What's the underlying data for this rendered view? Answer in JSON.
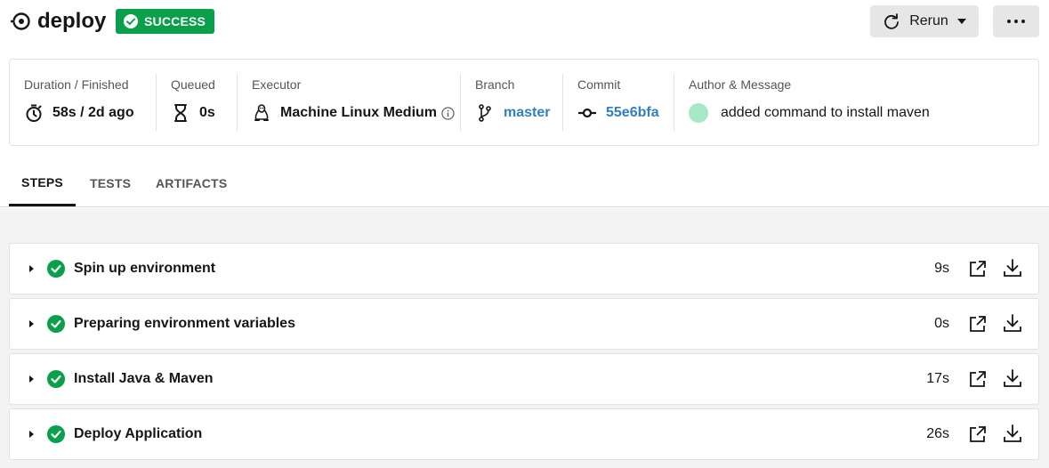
{
  "header": {
    "job_title": "deploy",
    "status": "SUCCESS",
    "rerun_label": "Rerun"
  },
  "info": {
    "duration": {
      "label": "Duration / Finished",
      "value": "58s / 2d ago"
    },
    "queued": {
      "label": "Queued",
      "value": "0s"
    },
    "executor": {
      "label": "Executor",
      "value": "Machine Linux Medium"
    },
    "branch": {
      "label": "Branch",
      "value": "master"
    },
    "commit": {
      "label": "Commit",
      "value": "55e6bfa"
    },
    "author": {
      "label": "Author & Message",
      "value": "added command to install maven"
    }
  },
  "tabs": [
    {
      "label": "STEPS",
      "active": true
    },
    {
      "label": "TESTS",
      "active": false
    },
    {
      "label": "ARTIFACTS",
      "active": false
    }
  ],
  "steps": [
    {
      "name": "Spin up environment",
      "duration": "9s"
    },
    {
      "name": "Preparing environment variables",
      "duration": "0s"
    },
    {
      "name": "Install Java & Maven",
      "duration": "17s"
    },
    {
      "name": "Deploy Application",
      "duration": "26s"
    }
  ],
  "colors": {
    "success": "#0a9f4a",
    "link": "#2f7fc1",
    "button_bg": "#e6e6e6",
    "steps_bg": "#f3f3f3"
  },
  "icons": {
    "job": "pipeline-job-icon",
    "status": "check-circle-icon",
    "rerun": "refresh-icon",
    "more": "ellipsis-icon",
    "duration": "stopwatch-icon",
    "queued": "hourglass-icon",
    "executor": "linux-penguin-icon",
    "info": "info-icon",
    "branch": "git-branch-icon",
    "commit": "git-commit-icon",
    "author": "avatar-icon",
    "step_expand": "caret-right-icon",
    "step_status": "check-circle-icon",
    "step_open": "external-link-icon",
    "step_download": "download-icon"
  }
}
